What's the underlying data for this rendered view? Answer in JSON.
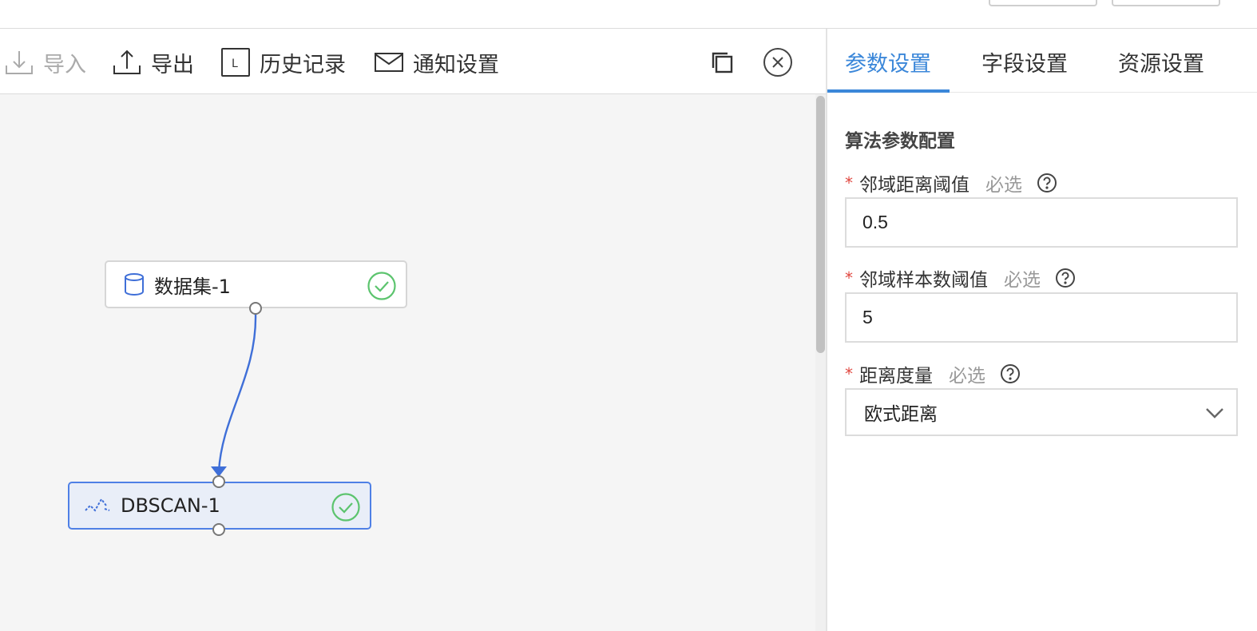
{
  "toolbar": {
    "import_label": "导入",
    "export_label": "导出",
    "history_label": "历史记录",
    "history_icon_letter": "L",
    "notify_label": "通知设置"
  },
  "canvas": {
    "nodes": [
      {
        "label": "数据集-1",
        "status": "success"
      },
      {
        "label": "DBSCAN-1",
        "status": "success",
        "selected": true
      }
    ]
  },
  "panel": {
    "tabs": [
      "参数设置",
      "字段设置",
      "资源设置"
    ],
    "active_tab": "参数设置",
    "section_title": "算法参数配置",
    "fields": [
      {
        "label": "邻域距离阈值",
        "hint": "必选",
        "required": true,
        "value": "0.5"
      },
      {
        "label": "邻域样本数阈值",
        "hint": "必选",
        "required": true,
        "value": "5"
      },
      {
        "label": "距离度量",
        "hint": "必选",
        "required": true,
        "value": "欧式距离"
      }
    ],
    "required_mark": "*"
  },
  "colors": {
    "accent": "#3b87d9",
    "node_selected_border": "#4f80e6",
    "success": "#5cc46e",
    "required": "#e0473f"
  }
}
